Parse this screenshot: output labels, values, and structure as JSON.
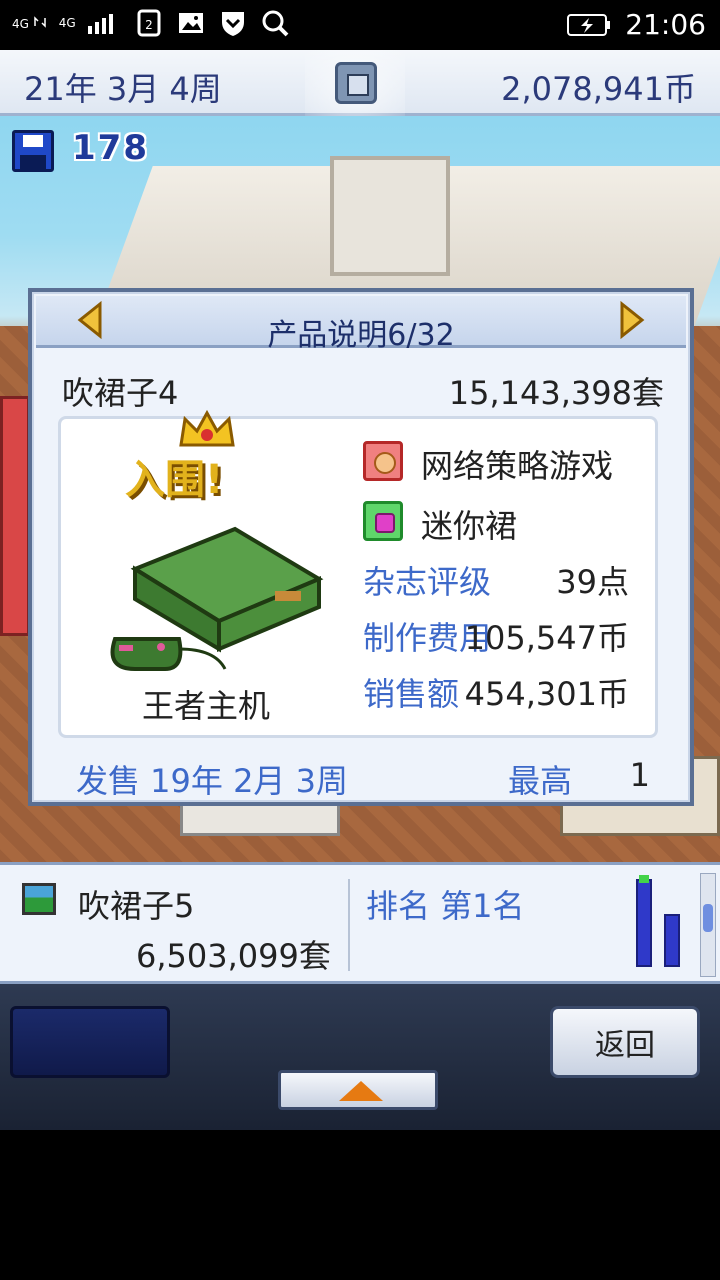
{
  "status_bar": {
    "net_left": "4G",
    "net_right": "4G",
    "time": "21:06"
  },
  "top_bar": {
    "date": "21年 3月 4周",
    "money": "2,078,941币"
  },
  "disk_count": "178",
  "dialog": {
    "title": "产品说明6/32",
    "game_name": "吹裙子4",
    "total_sales": "15,143,398套",
    "hall_of_fame": "入围!",
    "platform": "王者主机",
    "genre": "网络策略游戏",
    "type": "迷你裙",
    "magazine_label": "杂志评级",
    "magazine_value": "39点",
    "dev_cost_label": "制作费用",
    "dev_cost_value": "105,547币",
    "revenue_label": "销售额",
    "revenue_value": "454,301币",
    "release": "发售 19年 2月 3周",
    "best_label": "最高",
    "best_value": "1"
  },
  "info_panel": {
    "name": "吹裙子5",
    "sales": "6,503,099套",
    "rank": "排名 第1名",
    "bar_levels": [
      1.0,
      0.6
    ]
  },
  "controls": {
    "back_label": "返回"
  },
  "colors": {
    "label_blue": "#3d69c9",
    "title_navy": "#1d2f6a",
    "accent_orange": "#e67a12"
  }
}
